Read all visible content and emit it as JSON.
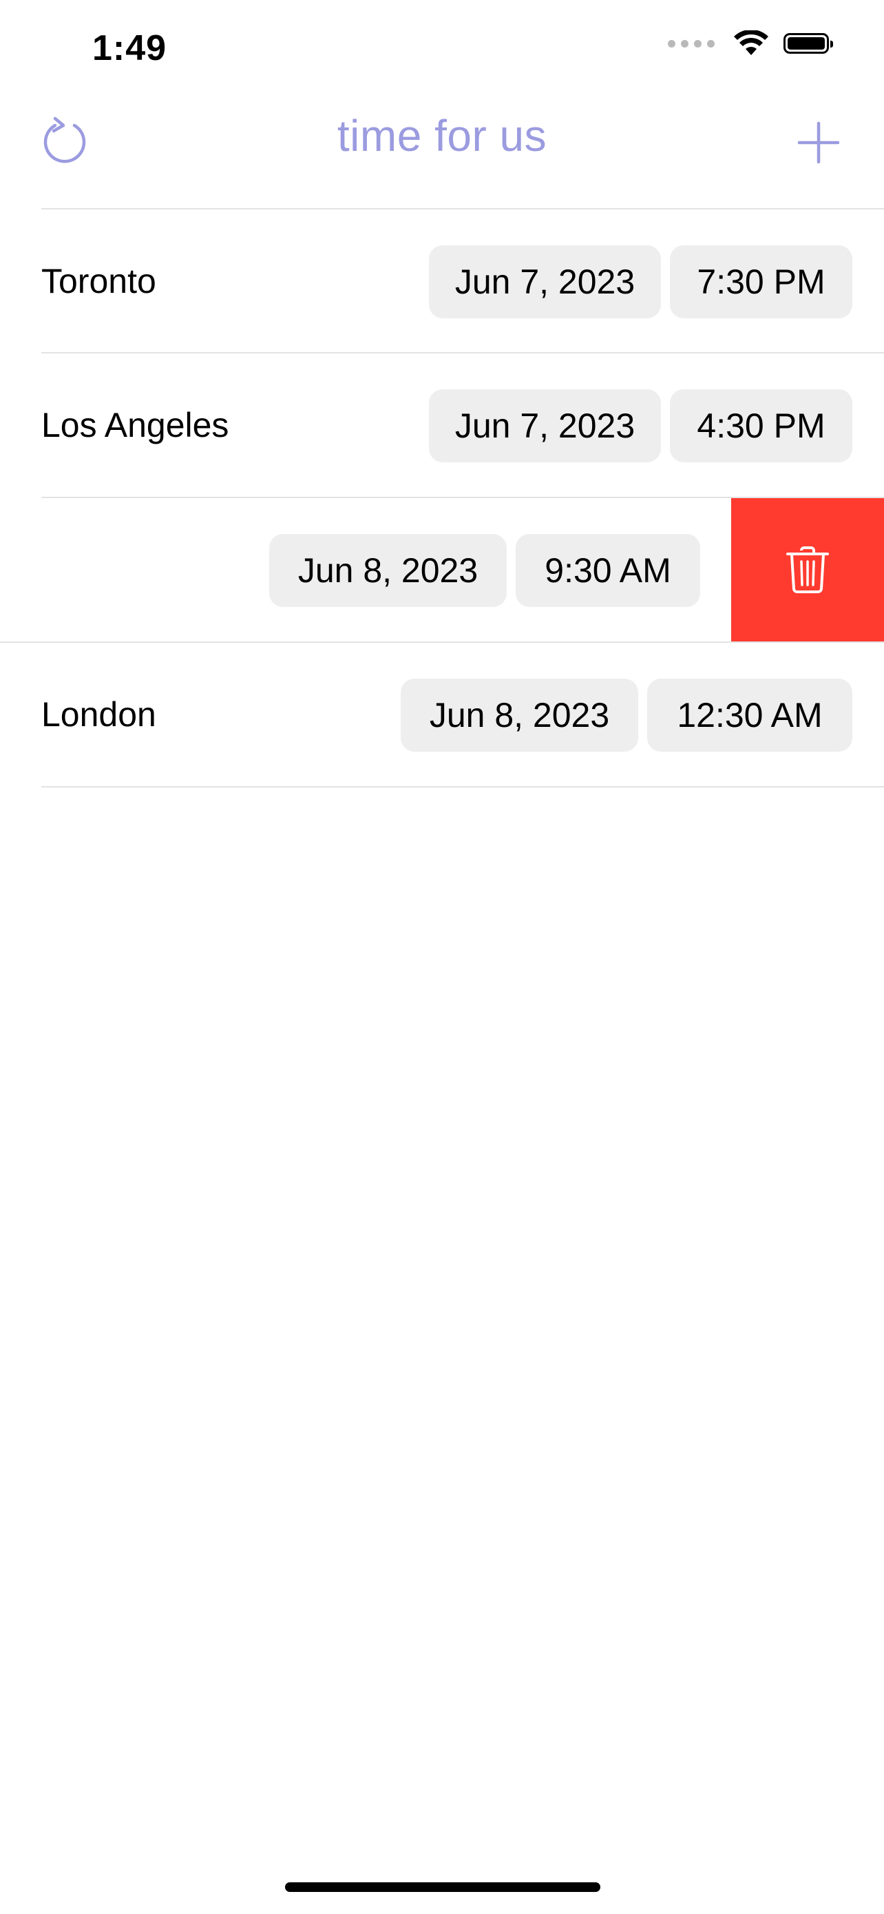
{
  "status_bar": {
    "time": "1:49",
    "icons": [
      "signal-dots-icon",
      "wifi-icon",
      "battery-icon"
    ]
  },
  "nav": {
    "title": "time for us",
    "left_icon": "refresh-icon",
    "right_icon": "plus-icon",
    "accent_color": "#9b9be0"
  },
  "rows": [
    {
      "city": "Toronto",
      "date": "Jun 7, 2023",
      "time": "7:30 PM"
    },
    {
      "city": "Los Angeles",
      "date": "Jun 7, 2023",
      "time": "4:30 PM"
    },
    {
      "city": "",
      "date": "Jun 8, 2023",
      "time": "9:30 AM",
      "swiped": true,
      "delete_icon": "trash-icon",
      "delete_color": "#ff3b30"
    },
    {
      "city": "London",
      "date": "Jun 8, 2023",
      "time": "12:30 AM"
    }
  ]
}
